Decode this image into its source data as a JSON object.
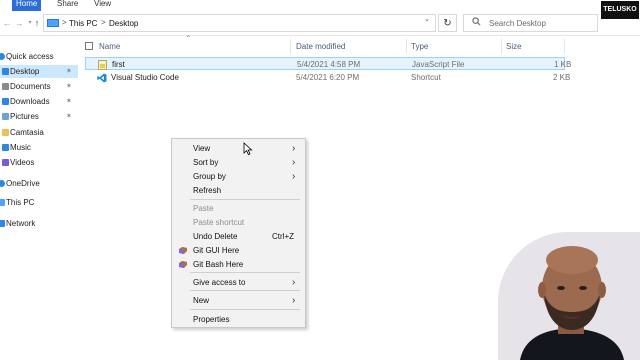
{
  "ribbon": {
    "tabs": [
      "Home",
      "Share",
      "View"
    ]
  },
  "address": {
    "crumbs": [
      "This PC",
      "Desktop"
    ],
    "separator": ">"
  },
  "search": {
    "placeholder": "Search Desktop"
  },
  "brand": "TELUSKO",
  "nav": {
    "items": [
      {
        "label": "Quick access",
        "icon": "star-icon",
        "pinned": false
      },
      {
        "label": "Desktop",
        "icon": "desktop-icon",
        "pinned": true,
        "selected": true
      },
      {
        "label": "Documents",
        "icon": "documents-icon",
        "pinned": true
      },
      {
        "label": "Downloads",
        "icon": "downloads-icon",
        "pinned": true
      },
      {
        "label": "Pictures",
        "icon": "pictures-icon",
        "pinned": true
      },
      {
        "label": "Camtasia",
        "icon": "folder-icon",
        "pinned": false
      },
      {
        "label": "Music",
        "icon": "music-icon",
        "pinned": false
      },
      {
        "label": "Videos",
        "icon": "videos-icon",
        "pinned": false
      },
      {
        "label": "OneDrive",
        "icon": "onedrive-icon",
        "pinned": false
      },
      {
        "label": "This PC",
        "icon": "this-pc-icon",
        "pinned": false
      },
      {
        "label": "Network",
        "icon": "network-icon",
        "pinned": false
      }
    ]
  },
  "columns": [
    "Name",
    "Date modified",
    "Type",
    "Size"
  ],
  "files": [
    {
      "name": "first",
      "date": "5/4/2021 4:58 PM",
      "type": "JavaScript File",
      "size": "1 KB",
      "icon": "js-file-icon"
    },
    {
      "name": "Visual Studio Code",
      "date": "5/4/2021 6:20 PM",
      "type": "Shortcut",
      "size": "2 KB",
      "icon": "vscode-icon"
    }
  ],
  "context_menu": {
    "items": [
      {
        "label": "View",
        "submenu": true
      },
      {
        "label": "Sort by",
        "submenu": true
      },
      {
        "label": "Group by",
        "submenu": true
      },
      {
        "label": "Refresh"
      },
      {
        "label": "Paste",
        "disabled": true
      },
      {
        "label": "Paste shortcut",
        "disabled": true
      },
      {
        "label": "Undo Delete",
        "shortcut": "Ctrl+Z"
      },
      {
        "label": "Git GUI Here",
        "icon": "git-icon"
      },
      {
        "label": "Git Bash Here",
        "icon": "git-icon"
      },
      {
        "label": "Give access to",
        "submenu": true
      },
      {
        "label": "New",
        "submenu": true
      },
      {
        "label": "Properties"
      }
    ]
  },
  "colors": {
    "accent": "#2b6fd6",
    "selection": "#cce8ff",
    "menu_bg": "#f2f2f2",
    "disabled_text": "#8e8e8e"
  }
}
